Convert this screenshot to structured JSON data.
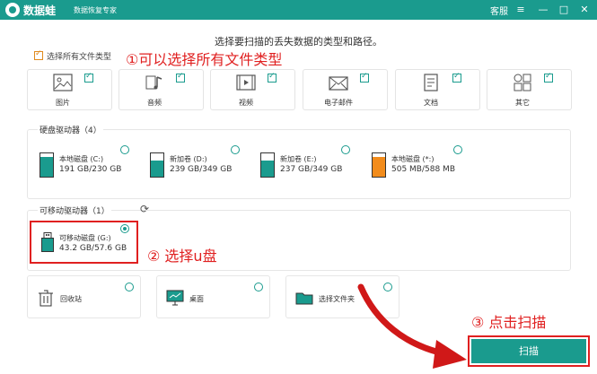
{
  "titlebar": {
    "app_name": "数据蛙",
    "app_subtitle": "数据恢复专家",
    "service_link": "客服",
    "icons": [
      "menu-icon",
      "minimize-icon",
      "maximize-icon",
      "close-icon"
    ]
  },
  "header": {
    "title": "选择要扫描的丢失数据的类型和路径。",
    "select_all_label": "选择所有文件类型"
  },
  "annotations": {
    "step1": "①可以选择所有文件类型",
    "step2": "② 选择u盘",
    "step3": "③ 点击扫描"
  },
  "file_types": [
    {
      "label": "图片",
      "icon": "image-icon",
      "checked": true
    },
    {
      "label": "音频",
      "icon": "music-icon",
      "checked": true
    },
    {
      "label": "视频",
      "icon": "video-icon",
      "checked": true
    },
    {
      "label": "电子邮件",
      "icon": "mail-icon",
      "checked": true
    },
    {
      "label": "文档",
      "icon": "document-icon",
      "checked": true
    },
    {
      "label": "其它",
      "icon": "other-icon",
      "checked": true
    }
  ],
  "hard_drives": {
    "label": "硬盘驱动器（4）",
    "drives": [
      {
        "name": "本地磁盘 (C:)",
        "size": "191 GB/230 GB",
        "used_fraction": 0.83,
        "color": "#1a9b8e",
        "selected": false
      },
      {
        "name": "新加卷 (D:)",
        "size": "239 GB/349 GB",
        "used_fraction": 0.68,
        "color": "#1a9b8e",
        "selected": false
      },
      {
        "name": "新加卷 (E:)",
        "size": "237 GB/349 GB",
        "used_fraction": 0.68,
        "color": "#1a9b8e",
        "selected": false
      },
      {
        "name": "本地磁盘 (*:)",
        "size": "505 MB/588 MB",
        "used_fraction": 0.86,
        "color": "#f28c1c",
        "selected": false
      }
    ]
  },
  "removable_drives": {
    "label": "可移动驱动器（1）",
    "refresh_icon": "refresh-icon",
    "drives": [
      {
        "name": "可移动磁盘 (G:)",
        "size": "43.2 GB/57.6 GB",
        "selected": true
      }
    ]
  },
  "locations": [
    {
      "label": "回收站",
      "icon": "trash-icon"
    },
    {
      "label": "桌面",
      "icon": "desktop-icon"
    },
    {
      "label": "选择文件夹",
      "icon": "folder-icon"
    }
  ],
  "scan_button": "扫描",
  "colors": {
    "accent": "#1a9b8e",
    "annotation": "#e02020",
    "orange": "#f28c1c"
  }
}
